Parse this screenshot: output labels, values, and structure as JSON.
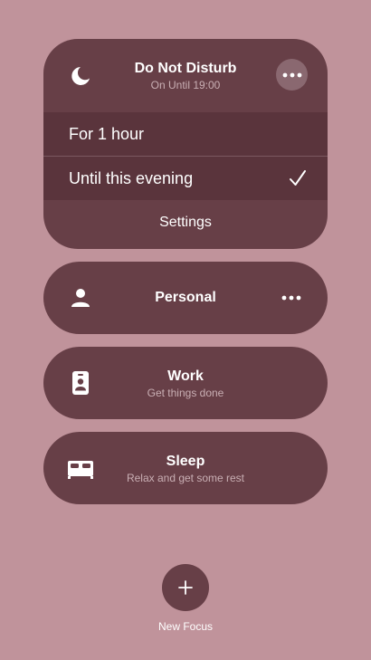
{
  "dnd": {
    "title": "Do Not Disturb",
    "subtitle": "On Until 19:00",
    "options": [
      {
        "label": "For 1 hour",
        "selected": false
      },
      {
        "label": "Until this evening",
        "selected": true
      }
    ],
    "settings_label": "Settings",
    "icon": "moon-icon"
  },
  "focus_modes": [
    {
      "title": "Personal",
      "subtitle": "",
      "icon": "person-icon"
    },
    {
      "title": "Work",
      "subtitle": "Get things done",
      "icon": "id-badge-icon"
    },
    {
      "title": "Sleep",
      "subtitle": "Relax and get some rest",
      "icon": "bed-icon"
    }
  ],
  "new_focus": {
    "label": "New Focus",
    "icon": "plus-icon"
  },
  "colors": {
    "background": "#c0939b",
    "card": "#673f47",
    "option_row": "#5a343c",
    "secondary_text": "#c9afb4"
  }
}
